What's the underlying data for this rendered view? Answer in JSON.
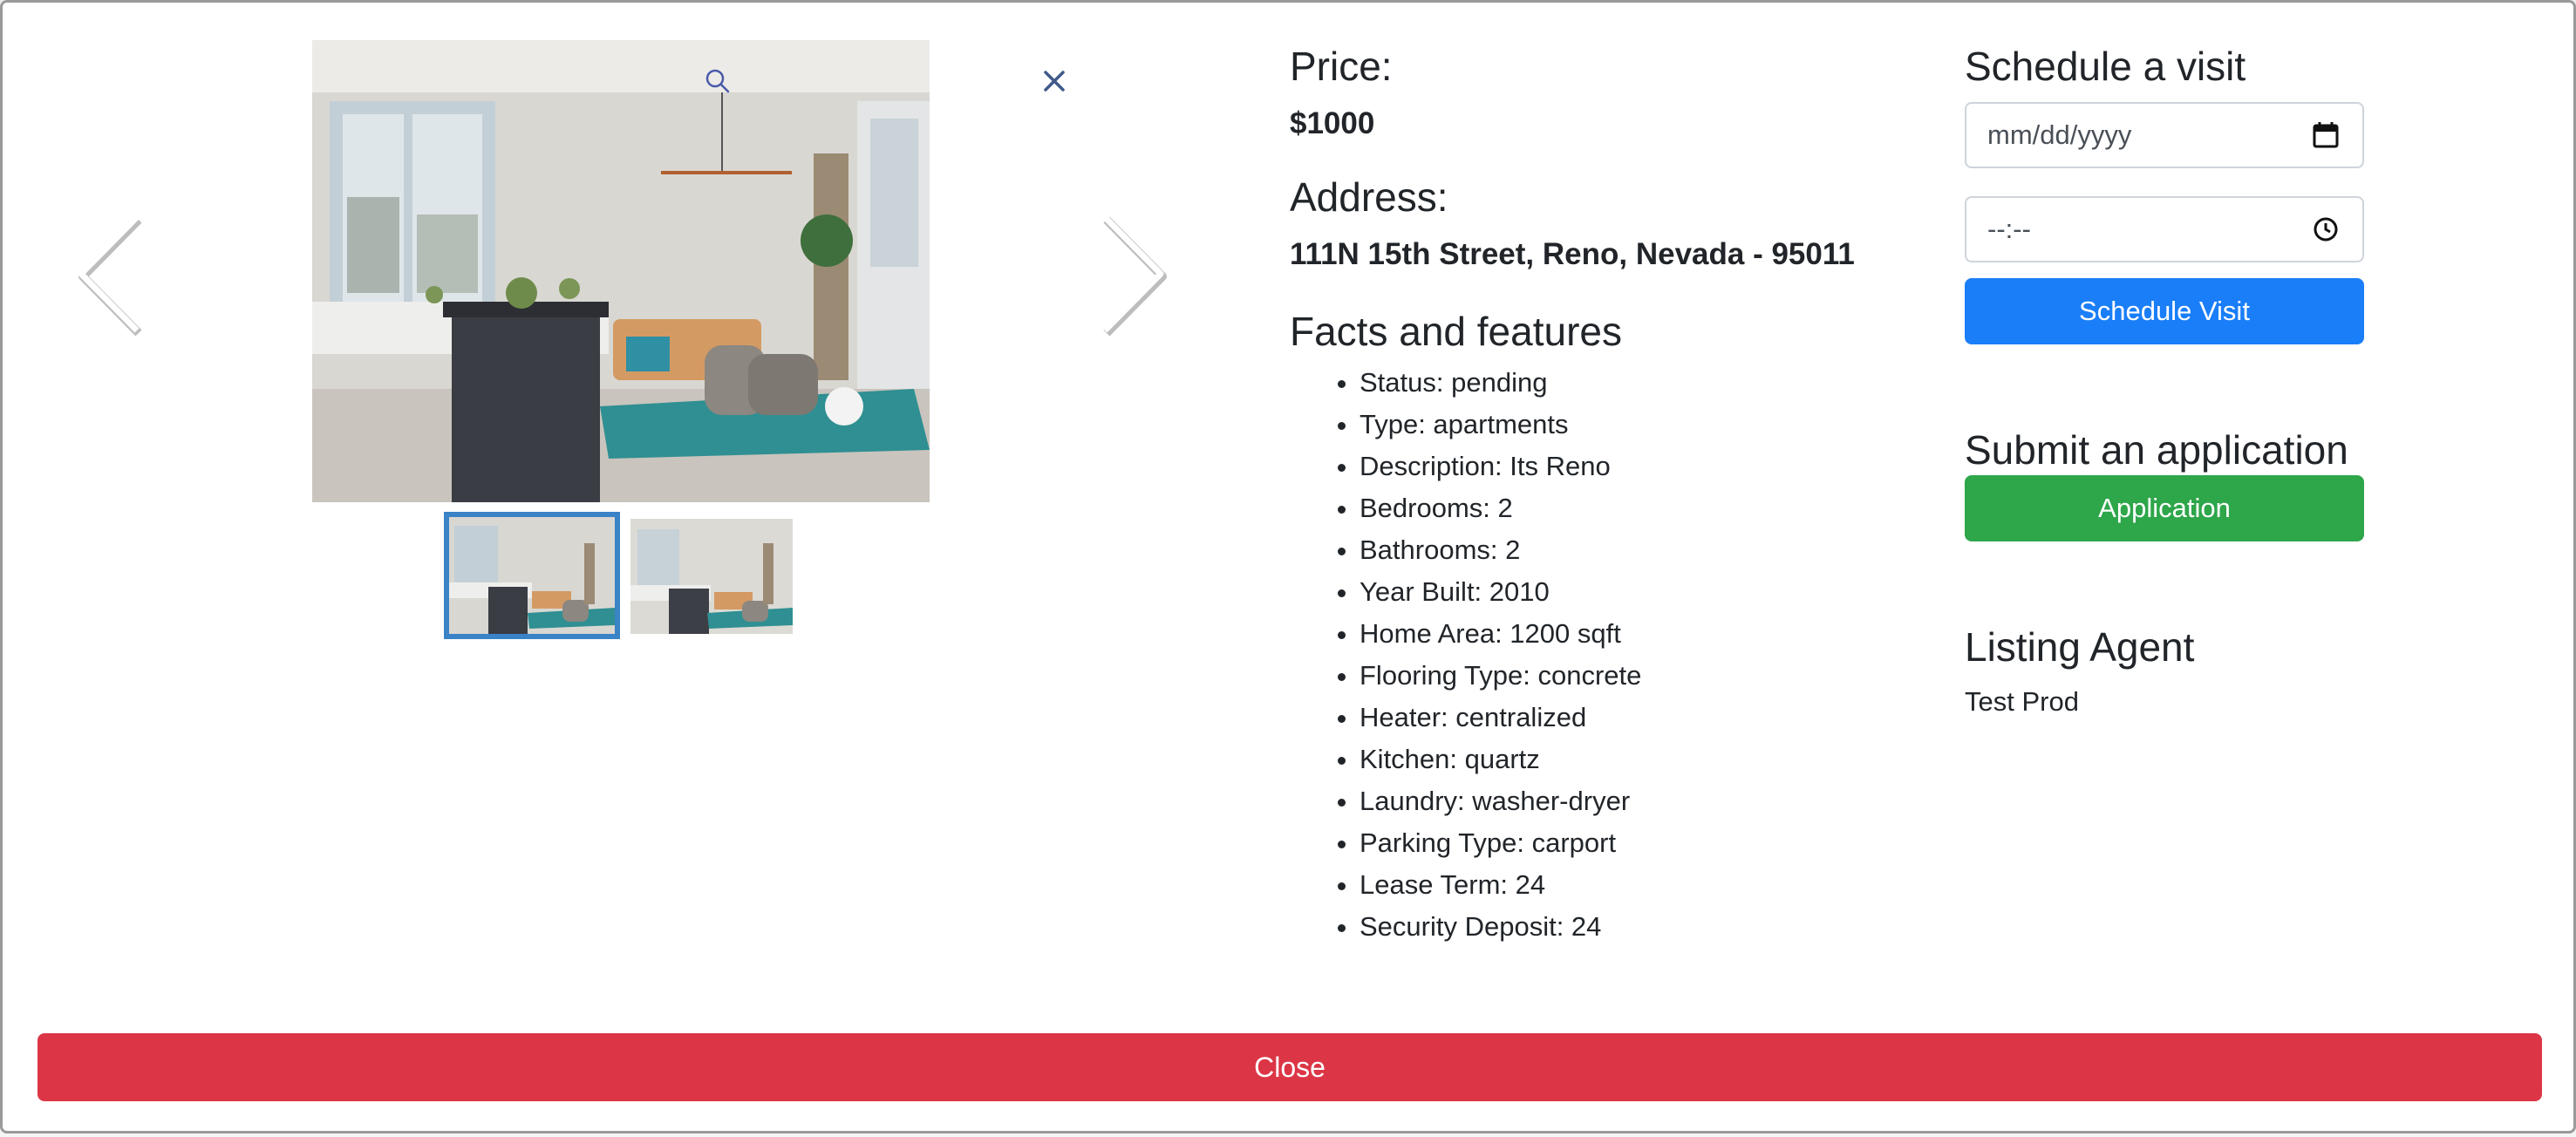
{
  "modal": {
    "price_heading": "Price:",
    "price_value": "$1000",
    "address_heading": "Address:",
    "address_value": "111N 15th Street, Reno, Nevada - 95011",
    "facts_heading": "Facts and features",
    "facts": [
      "Status: pending",
      "Type: apartments",
      "Description: Its Reno",
      "Bedrooms: 2",
      "Bathrooms: 2",
      "Year Built: 2010",
      "Home Area: 1200 sqft",
      "Flooring Type: concrete",
      "Heater: centralized",
      "Kitchen: quartz",
      "Laundry: washer-dryer",
      "Parking Type: carport",
      "Lease Term: 24",
      "Security Deposit: 24"
    ]
  },
  "gallery": {
    "icons": [
      "zoom-icon",
      "close-icon",
      "chevron-left-icon",
      "chevron-right-icon"
    ],
    "thumbnail_count": 2,
    "active_thumbnail": 1
  },
  "schedule": {
    "heading": "Schedule a visit",
    "date_placeholder": "mm/dd/yyyy",
    "time_placeholder": "--:--",
    "button_label": "Schedule Visit"
  },
  "application": {
    "heading": "Submit an application",
    "button_label": "Application"
  },
  "agent": {
    "heading": "Listing Agent",
    "name": "Test Prod"
  },
  "footer": {
    "close_label": "Close"
  },
  "colors": {
    "primary": "#1a7ef8",
    "success": "#2ea64a",
    "danger": "#dc3646",
    "thumb_active_border": "#3a83c6"
  }
}
